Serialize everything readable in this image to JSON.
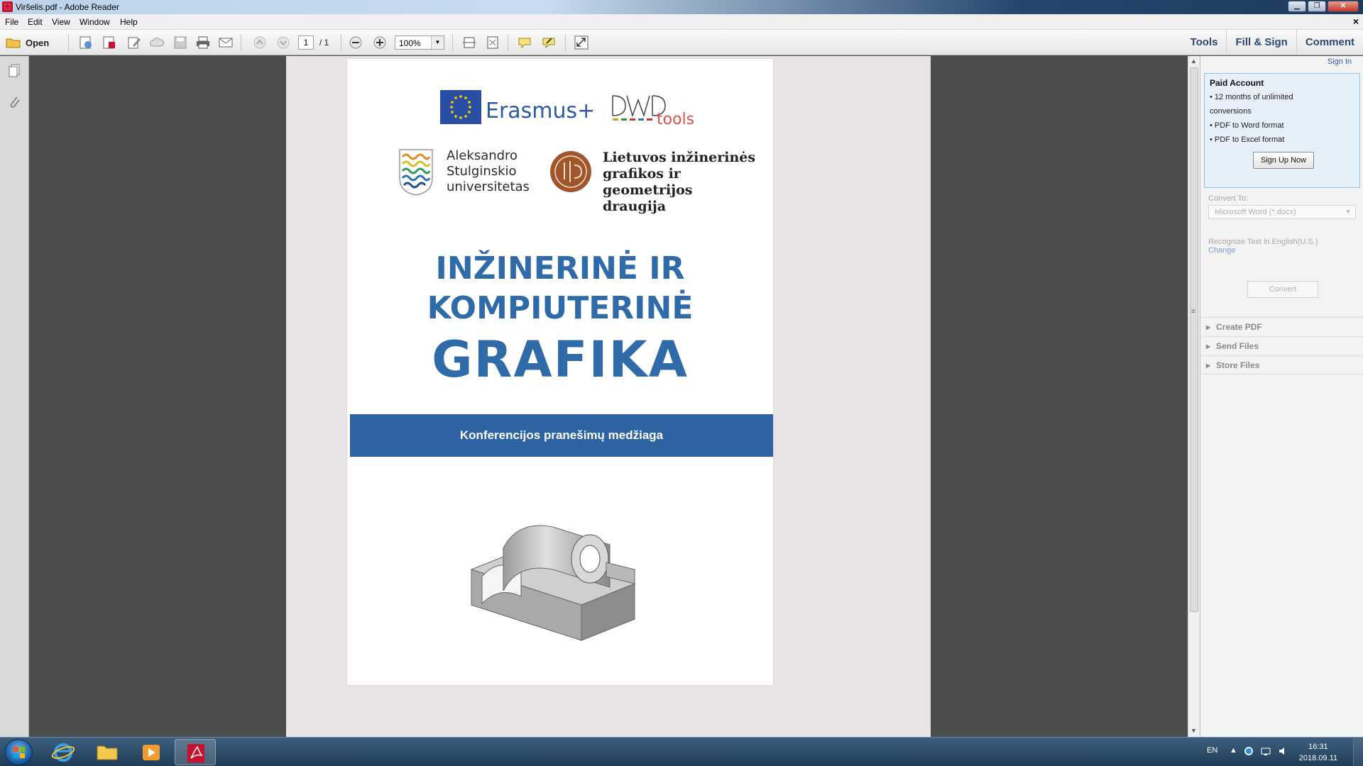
{
  "window": {
    "title": "Viršelis.pdf - Adobe Reader"
  },
  "menubar": {
    "items": [
      "File",
      "Edit",
      "View",
      "Window",
      "Help"
    ]
  },
  "toolbar": {
    "open_label": "Open",
    "page_current": "1",
    "page_total": "/ 1",
    "zoom": "100%",
    "tabs": [
      "Tools",
      "Fill & Sign",
      "Comment"
    ]
  },
  "cover": {
    "erasmus": "Erasmus+",
    "dwd_tools": "tools",
    "university": [
      "Aleksandro",
      "Stulginskio",
      "universitetas"
    ],
    "society": [
      "Lietuvos inžinerinės",
      "grafikos ir geometrijos",
      "draugija"
    ],
    "title_line1": "INŽINERINĖ IR",
    "title_line2": "KOMPIUTERINĖ",
    "title_line3": "GRAFIKA",
    "banner": "Konferencijos pranešimų medžiaga"
  },
  "right_panel": {
    "sign_in": "Sign In",
    "paid_title": "Paid Account",
    "paid_lines": [
      "• 12 months of unlimited",
      "conversions",
      "• PDF to Word format",
      "• PDF to Excel format"
    ],
    "signup_label": "Sign Up Now",
    "convert_to_label": "Convert To:",
    "convert_option": "Microsoft Word (*.docx)",
    "recognize_text": "Recognize Text in English(U.S.)",
    "change_link": "Change",
    "convert_button": "Convert",
    "sections": [
      "Create PDF",
      "Send Files",
      "Store Files"
    ]
  },
  "taskbar": {
    "language": "EN",
    "time": "16:31",
    "date": "2018.09.11"
  },
  "colors": {
    "accent_blue": "#2f6aa9",
    "banner_blue": "#2e63a3",
    "tab_text": "#2c4a73"
  }
}
